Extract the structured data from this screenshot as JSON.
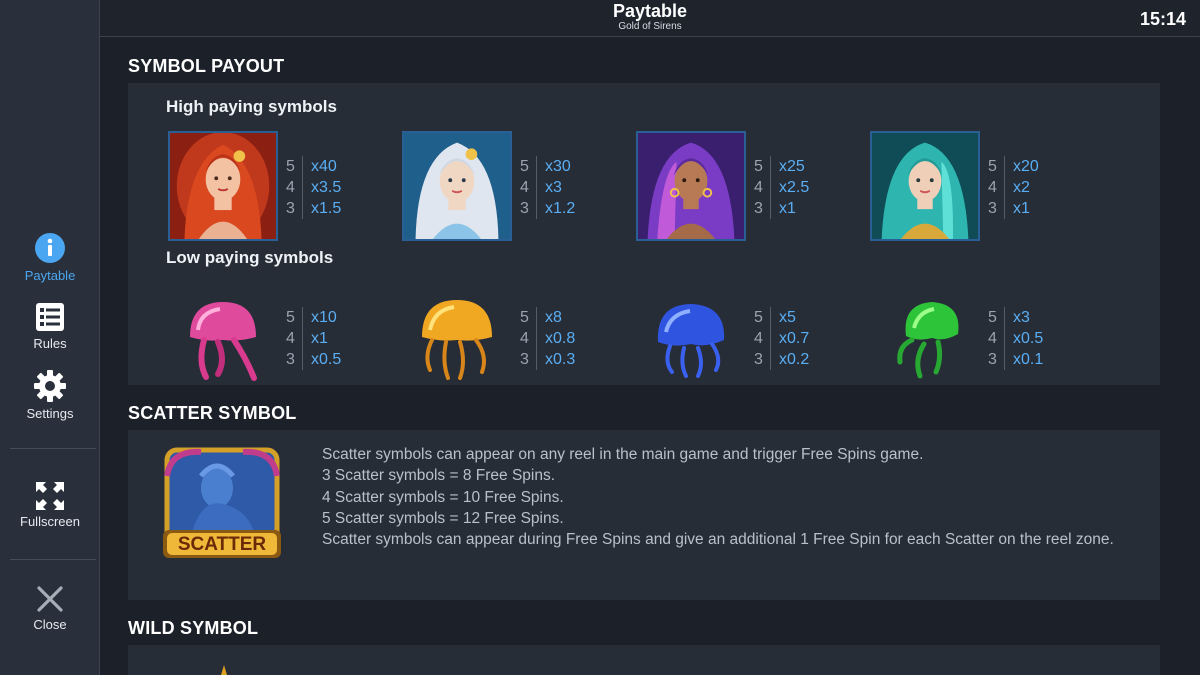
{
  "header": {
    "title": "Paytable",
    "subtitle": "Gold of Sirens",
    "time": "15:14"
  },
  "sidebar": {
    "items": [
      {
        "label": "Paytable",
        "icon": "info-icon",
        "active": true
      },
      {
        "label": "Rules",
        "icon": "list-icon"
      },
      {
        "label": "Settings",
        "icon": "gear-icon"
      },
      {
        "label": "Fullscreen",
        "icon": "fullscreen-icon"
      },
      {
        "label": "Close",
        "icon": "close-icon"
      }
    ]
  },
  "symbol_payout": {
    "title": "SYMBOL PAYOUT",
    "high_title": "High paying symbols",
    "low_title": "Low paying symbols",
    "high": [
      {
        "name": "red-siren",
        "pays": [
          [
            "5",
            "x40"
          ],
          [
            "4",
            "x3.5"
          ],
          [
            "3",
            "x1.5"
          ]
        ]
      },
      {
        "name": "silver-siren",
        "pays": [
          [
            "5",
            "x30"
          ],
          [
            "4",
            "x3"
          ],
          [
            "3",
            "x1.2"
          ]
        ]
      },
      {
        "name": "purple-siren",
        "pays": [
          [
            "5",
            "x25"
          ],
          [
            "4",
            "x2.5"
          ],
          [
            "3",
            "x1"
          ]
        ]
      },
      {
        "name": "teal-siren",
        "pays": [
          [
            "5",
            "x20"
          ],
          [
            "4",
            "x2"
          ],
          [
            "3",
            "x1"
          ]
        ]
      }
    ],
    "low": [
      {
        "name": "pink-jellyfish",
        "pays": [
          [
            "5",
            "x10"
          ],
          [
            "4",
            "x1"
          ],
          [
            "3",
            "x0.5"
          ]
        ]
      },
      {
        "name": "yellow-jellyfish",
        "pays": [
          [
            "5",
            "x8"
          ],
          [
            "4",
            "x0.8"
          ],
          [
            "3",
            "x0.3"
          ]
        ]
      },
      {
        "name": "blue-jellyfish",
        "pays": [
          [
            "5",
            "x5"
          ],
          [
            "4",
            "x0.7"
          ],
          [
            "3",
            "x0.2"
          ]
        ]
      },
      {
        "name": "green-jellyfish",
        "pays": [
          [
            "5",
            "x3"
          ],
          [
            "4",
            "x0.5"
          ],
          [
            "3",
            "x0.1"
          ]
        ]
      }
    ]
  },
  "scatter": {
    "title": "SCATTER SYMBOL",
    "badge": "SCATTER",
    "lines": [
      "Scatter symbols can appear on any reel in the main game and trigger Free Spins game.",
      "3 Scatter symbols = 8 Free Spins.",
      "4 Scatter symbols = 10 Free Spins.",
      "5 Scatter symbols = 12 Free Spins.",
      "Scatter symbols can appear during Free Spins and give an additional 1 Free Spin for each Scatter on the reel zone."
    ]
  },
  "wild": {
    "title": "WILD SYMBOL"
  },
  "colors": {
    "accent": "#4aa6f0",
    "payout": "#5aaef3",
    "panel": "#272d37",
    "background": "#1c2129"
  }
}
